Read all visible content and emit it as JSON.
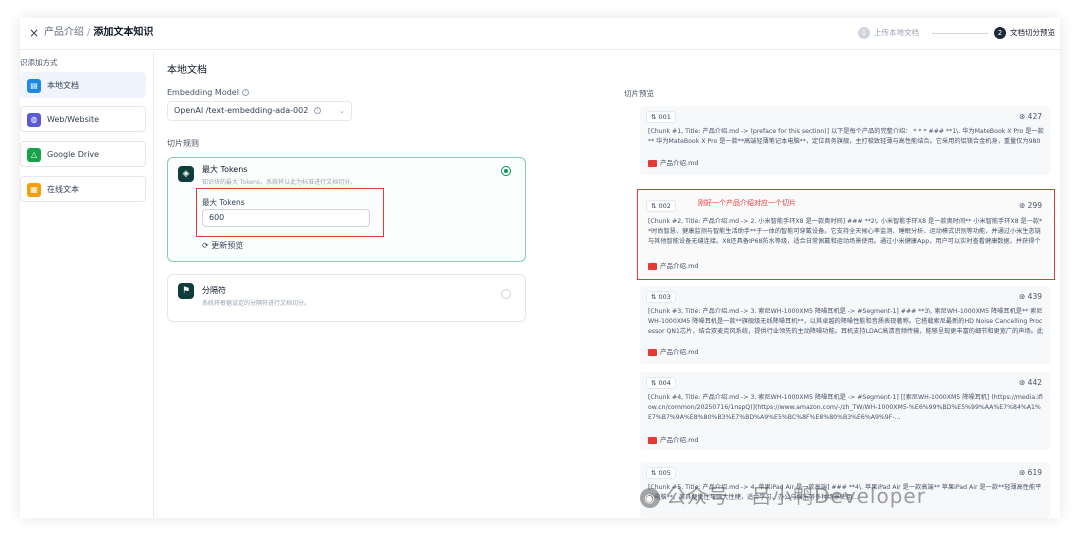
{
  "header": {
    "close": "×",
    "crumb_parent": "产品介绍",
    "crumb_sep": "/",
    "crumb_current": "添加文本知识",
    "steps": [
      {
        "num": "1",
        "label": "上传本地文档"
      },
      {
        "num": "2",
        "label": "文档切分预览"
      }
    ]
  },
  "sidebar": {
    "title": "识添加方式",
    "items": [
      {
        "label": "本地文档",
        "icon": "file-icon",
        "color": "#1e88e5"
      },
      {
        "label": "Web/Website",
        "icon": "globe-icon",
        "color": "#5b5bd6"
      },
      {
        "label": "Google Drive",
        "icon": "drive-icon",
        "color": "#16a34a"
      },
      {
        "label": "在线文本",
        "icon": "note-icon",
        "color": "#f59e0b"
      }
    ]
  },
  "main": {
    "title": "本地文档",
    "embedding_label": "Embedding Model",
    "embedding_value": "OpenAI /text-embedding-ada-002",
    "rules_label": "切片规则",
    "rule1": {
      "title": "最大 Tokens",
      "desc": "知识块的最大 Tokens，系统将以此为标准进行文档切分。",
      "input_label": "最大 Tokens",
      "input_value": "600",
      "refresh": "更新预览"
    },
    "rule2": {
      "title": "分隔符",
      "desc": "系统将根据设定的分隔符进行文档切分。"
    }
  },
  "preview": {
    "title": "切片预览",
    "annotation": "刚好一个产品介绍对应一个切片",
    "chunks": [
      {
        "id": "001",
        "count": "427",
        "text": "[Chunk #1, Title: 产品介绍.md -> (preface for this section)] 以下是每个产品的完整介绍： * * * ### **1\\. 华为MateBook X Pro 是一款** 华为MateBook X Pro 是一款**高端轻薄笔记本电脑**，定位商务旗舰，主打极致轻薄与高性能结合。它采用的铝镁合金机身，重量仅为980克，厚度仅13.5毫米，开创了高性能笔记本\"云彩新纪元\"。搭载英特尔古骏睿**Ultra 9高性能处理器，配合全新鉴盘震韵系统，实现40W TDP高性...",
        "doc": "产品介绍.md"
      },
      {
        "id": "002",
        "count": "299",
        "text": "[Chunk #2, Title: 产品介绍.md -> 2. 小米智能手环X8 是一款奥时间] ### **2\\. 小米智能手环X8 是一款奥时间** 小米智能手环X8 是一款**时尚智慧、健康监测与智能生活助手**于一体的智能可穿戴设备。它支持全天候心率监测、睡眠分析、运动模式识别等功能，并通过小米生态链与其他智能设备无缝连接。X8还具备IP68防水等级，适合日常佩戴和运动场景使用。通过小米健康App，用户可以实时查看健康数据，并获得个性化建...",
        "doc": "产品介绍.md"
      },
      {
        "id": "003",
        "count": "439",
        "text": "[Chunk #3, Title: 产品介绍.md -> 3. 索尼WH-1000XM5 降噪耳机是 -> #Segment-1] ### **3\\. 索尼WH-1000XM5 降噪耳机是** 索尼WH-1000XM5 降噪耳机是一款**旗舰级无线降噪耳机**，以其卓越的降噪性能和音质表现著称。它搭载索尼最新的HD Noise Cancelling Processor QN1芯片，结合双麦克风系统，提供行业领先的主动降噪功能。耳机支持LDAC高清音频传输，能够呈现更丰富的细节和更宽广的声场。此外，...",
        "doc": "产品介绍.md"
      },
      {
        "id": "004",
        "count": "442",
        "text": "[Chunk #4, Title: 产品介绍.md -> 3. 索尼WH-1000XM5 降噪耳机是 -> #Segment-1] [[索尼WH-1000XM5 降噪耳机] (https://media.iflow.cn/common/20250716/1nspQ)](https://www.amazon.com/-/zh_TW/WH-1000XM5-%E6%99%BD%E5%99%AA%E7%84%A1%E7%B7%9A%E8%80%B3%E7%BD%A9%E5%BC%8F%E8%80%B3%E6%A9%9F-...",
        "doc": "产品介绍.md"
      },
      {
        "id": "005",
        "count": "619",
        "text": "[Chunk #5, Title: 产品介绍.md -> 4. 苹果iPad Air 是一款高端] ### **4\\. 苹果iPad Air 是一款高端** 苹果iPad Air 是一款**轻薄高性能平板电脑**，兼具便携性与强大性能，适合学习、办公与娱乐等多种场景使用...",
        "doc": "产品介绍.md"
      }
    ]
  },
  "watermark": "公众号 · 吕小鸭Developer"
}
